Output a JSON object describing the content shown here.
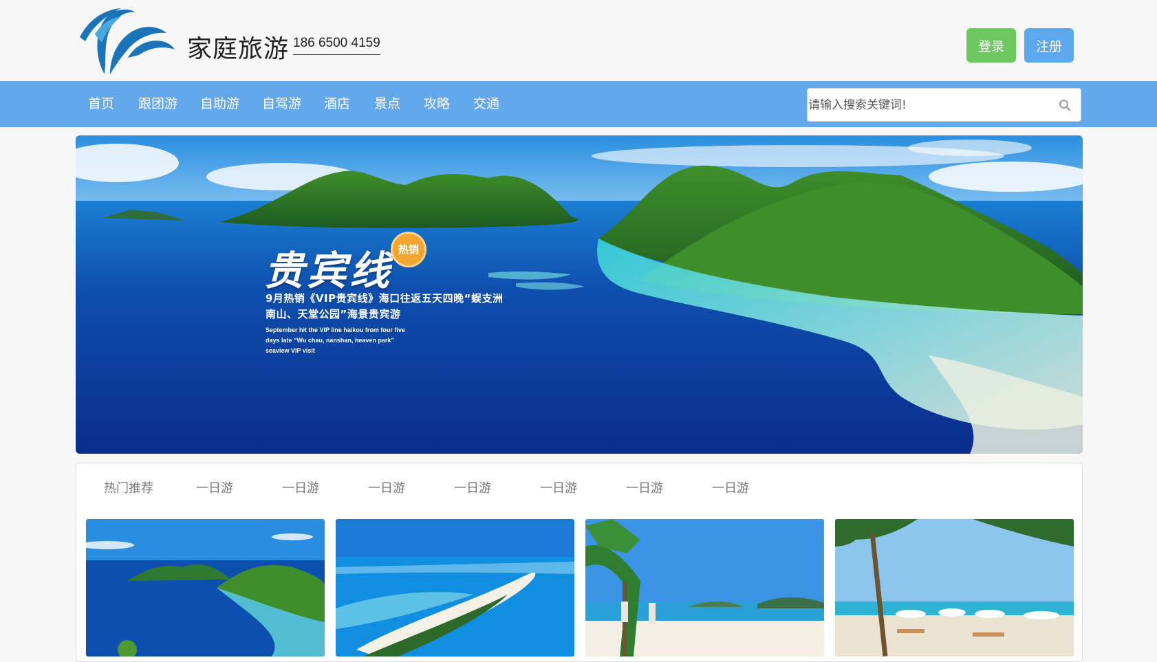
{
  "header": {
    "site_name": "家庭旅游",
    "phone": "186 6500 4159",
    "login_label": "登录",
    "register_label": "注册",
    "login_color": "#6cc85f",
    "register_color": "#5ba8ef"
  },
  "nav": {
    "items": [
      "首页",
      "跟团游",
      "自助游",
      "自驾游",
      "酒店",
      "景点",
      "攻略",
      "交通"
    ],
    "bar_color": "#64a8ec"
  },
  "search": {
    "placeholder": "请输入搜索关键词!",
    "icon": "search-icon"
  },
  "banner": {
    "title": "贵宾线",
    "badge": "热销",
    "line1": "9月热销《VIP贵宾线》海口往返五天四晚“蜈支洲",
    "line2": "南山、天堂公园”海景贵宾游",
    "english": "September hit the VIP line haikou from four five days late “Wu chau, nanshan, heaven park” seaview VIP visit"
  },
  "recommend": {
    "tabs": [
      "热门推荐",
      "一日游",
      "一日游",
      "一日游",
      "一日游",
      "一日游",
      "一日游",
      "一日游"
    ],
    "thumbs": [
      "island-aerial-photo",
      "sandbar-aerial-photo",
      "beach-palms-photo",
      "beach-umbrellas-photo"
    ]
  }
}
